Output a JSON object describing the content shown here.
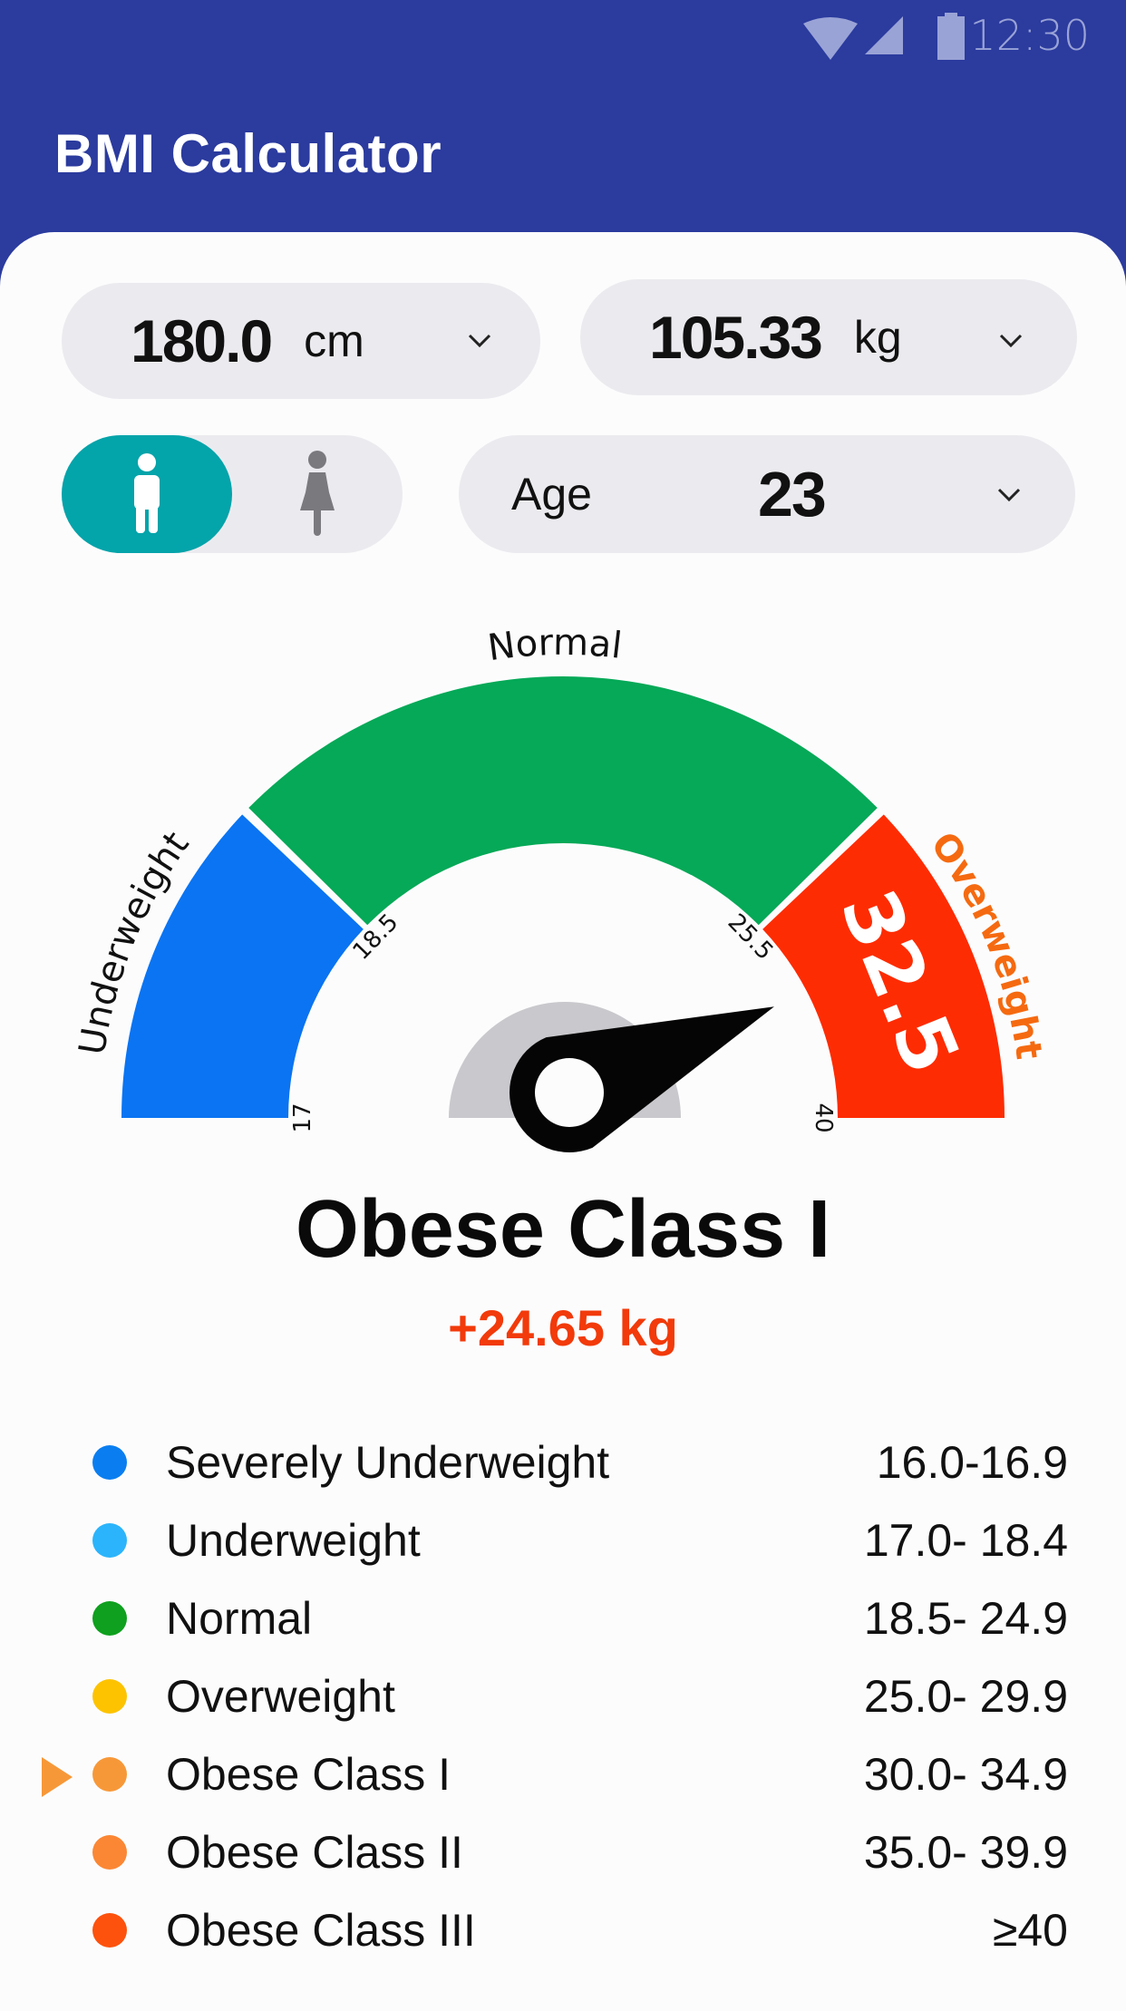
{
  "status_bar": {
    "time": "12:30",
    "icons": [
      "wifi-icon",
      "signal-icon",
      "battery-icon"
    ]
  },
  "app": {
    "title": "BMI Calculator"
  },
  "inputs": {
    "height": {
      "value": "180.0",
      "unit": "cm",
      "icon": "chevron-down-icon"
    },
    "weight": {
      "value": "105.33",
      "unit": "kg",
      "icon": "chevron-down-icon"
    },
    "gender": {
      "selected": "male",
      "options": [
        "male",
        "female"
      ],
      "accent": "#03a4aa"
    },
    "age": {
      "label": "Age",
      "value": "23",
      "icon": "chevron-down-icon"
    }
  },
  "gauge": {
    "segments": [
      {
        "label": "Underweight",
        "color": "#0a74f2",
        "from": 17,
        "to": 18.5
      },
      {
        "label": "Normal",
        "color": "#05a957",
        "from": 18.5,
        "to": 25.5
      },
      {
        "label": "Overweight",
        "color": "#fe2c02",
        "from": 25.5,
        "to": 40,
        "label_color": "#f56a10"
      }
    ],
    "ticks": [
      "17",
      "18.5",
      "25.5",
      "40"
    ],
    "value": "32.5",
    "needle_value": 32.5
  },
  "result": {
    "category": "Obese Class I",
    "delta": "+24.65 kg"
  },
  "legend": [
    {
      "label": "Severely Underweight",
      "range": "16.0-16.9",
      "color": "#0a7ef0",
      "active": false
    },
    {
      "label": "Underweight",
      "range": "17.0- 18.4",
      "color": "#2bb4fb",
      "active": false
    },
    {
      "label": "Normal",
      "range": "18.5- 24.9",
      "color": "#0ea01e",
      "active": false
    },
    {
      "label": "Overweight",
      "range": "25.0- 29.9",
      "color": "#fdc300",
      "active": false
    },
    {
      "label": "Obese Class I",
      "range": "30.0- 34.9",
      "color": "#f79838",
      "active": true
    },
    {
      "label": "Obese Class II",
      "range": "35.0- 39.9",
      "color": "#fb8734",
      "active": false
    },
    {
      "label": "Obese Class III",
      "range": "≥40",
      "color": "#fd520d",
      "active": false
    }
  ]
}
